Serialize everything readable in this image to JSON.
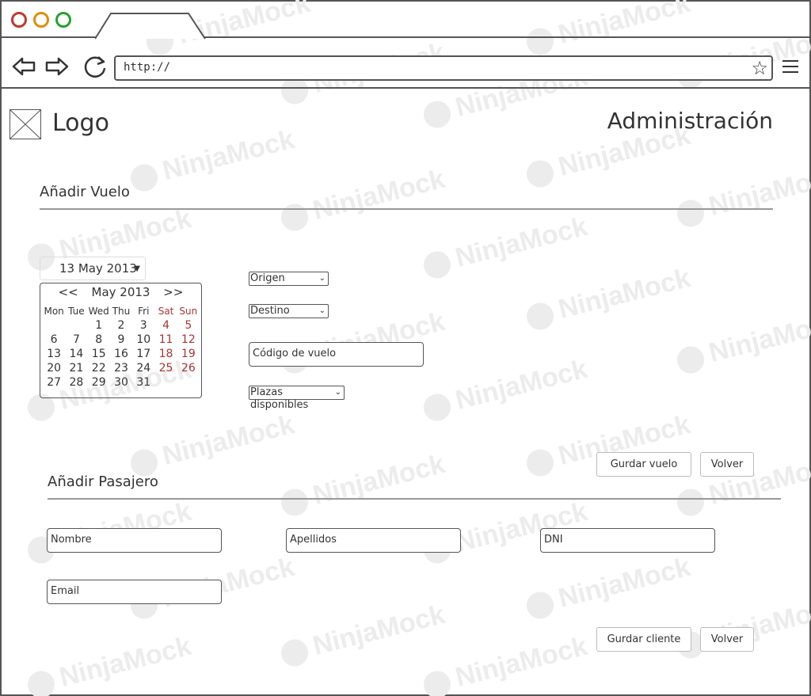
{
  "browser": {
    "url": "http://",
    "star_glyph": "☆"
  },
  "header": {
    "logo": "Logo",
    "title": "Administración"
  },
  "flight": {
    "section_title": "Añadir Vuelo",
    "date_value": "13 May 2013",
    "calendar": {
      "prev": "<<",
      "month_label": "May 2013",
      "next": ">>",
      "weekdays": [
        "Mon",
        "Tue",
        "Wed",
        "Thu",
        "Fri",
        "Sat",
        "Sun"
      ],
      "weeks": [
        [
          "",
          "",
          "1",
          "2",
          "3",
          "4",
          "5"
        ],
        [
          "6",
          "7",
          "8",
          "9",
          "10",
          "11",
          "12"
        ],
        [
          "13",
          "14",
          "15",
          "16",
          "17",
          "18",
          "19"
        ],
        [
          "20",
          "21",
          "22",
          "23",
          "24",
          "25",
          "26"
        ],
        [
          "27",
          "28",
          "29",
          "30",
          "31",
          "",
          ""
        ]
      ],
      "weekend_color": "#aa3333"
    },
    "origin_label": "Origen",
    "destination_label": "Destino",
    "flight_code_placeholder": "Código de vuelo",
    "seats_label": "Plazas disponibles",
    "save_button": "Gurdar vuelo",
    "back_button": "Volver"
  },
  "passenger": {
    "section_title": "Añadir Pasajero",
    "name_placeholder": "Nombre",
    "surname_placeholder": "Apellidos",
    "dni_placeholder": "DNI",
    "email_placeholder": "Email",
    "save_button": "Gurdar cliente",
    "back_button": "Volver"
  },
  "watermark": "NinjaMock",
  "icons": [
    "back-arrow-icon",
    "forward-arrow-icon",
    "reload-icon",
    "star-icon",
    "menu-icon",
    "logo-placeholder-icon",
    "dropdown-caret-icon"
  ]
}
